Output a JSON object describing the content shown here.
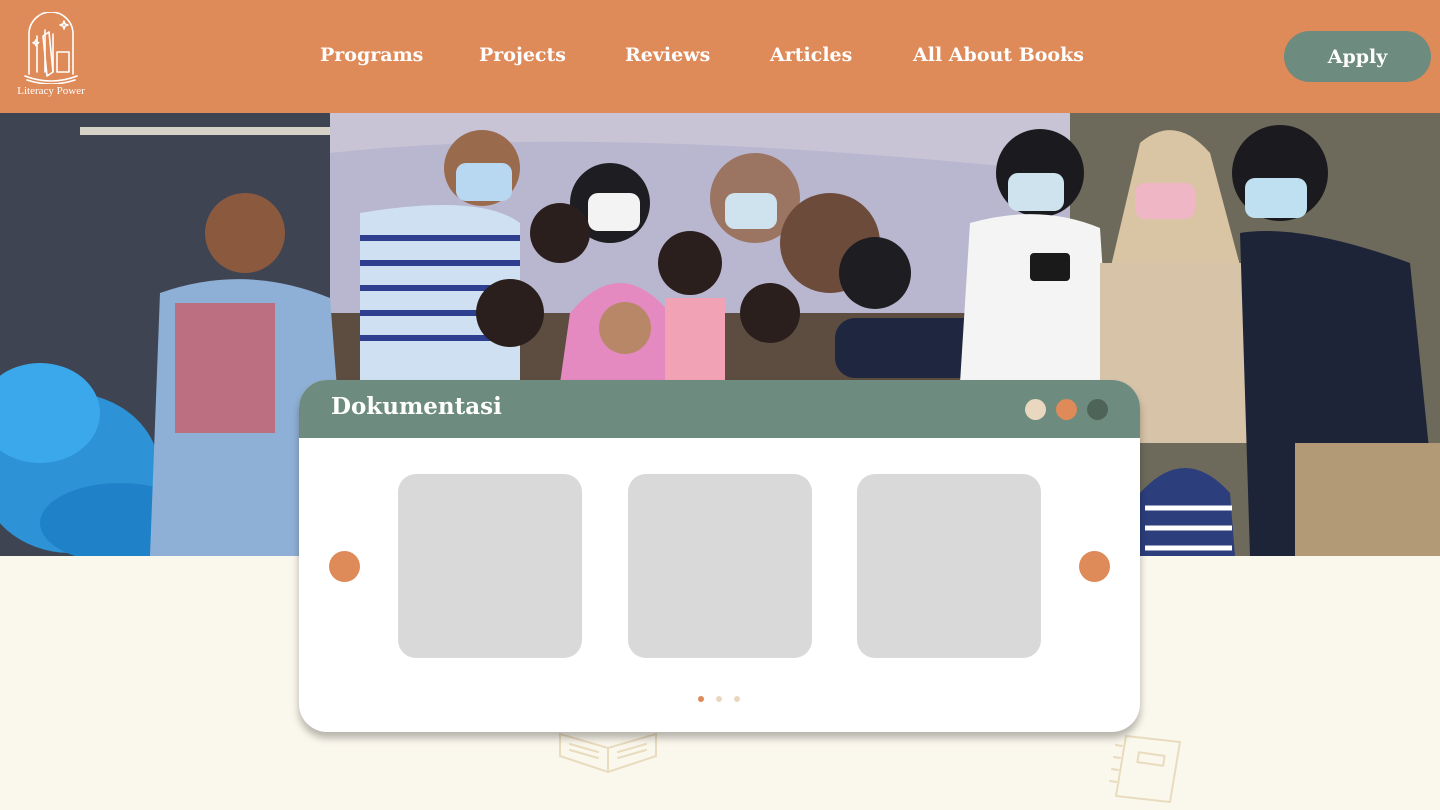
{
  "brand": {
    "name": "Literacy Power",
    "logo_icon": "book-arch-icon"
  },
  "nav": {
    "items": [
      {
        "label": "Programs"
      },
      {
        "label": "Projects"
      },
      {
        "label": "Reviews"
      },
      {
        "label": "Articles"
      },
      {
        "label": "All About Books"
      }
    ],
    "apply_label": "Apply"
  },
  "hero": {
    "image": "group-photo-volunteers-and-children"
  },
  "gallery": {
    "title": "Dokumentasi",
    "window_dots": [
      "#ead7c0",
      "#de8a59",
      "#4f6459"
    ],
    "prev_icon": "prev-arrow-icon",
    "next_icon": "next-arrow-icon",
    "slides": [
      {
        "name": "gallery-slide-1"
      },
      {
        "name": "gallery-slide-2"
      },
      {
        "name": "gallery-slide-3"
      }
    ],
    "pages": 3,
    "active_page": 1
  },
  "colors": {
    "header_bg": "#de8a59",
    "accent_green": "#6d8b7e",
    "page_bg": "#faf7ec",
    "placeholder": "#d9d9d9"
  }
}
